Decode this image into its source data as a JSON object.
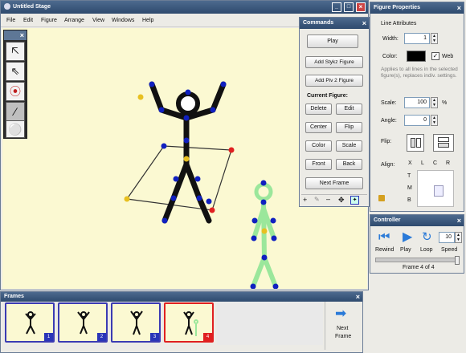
{
  "stage": {
    "title": "Untitled Stage",
    "menu": [
      "File",
      "Edit",
      "Figure",
      "Arrange",
      "View",
      "Windows",
      "Help"
    ],
    "win_controls": [
      "_",
      "□",
      "×"
    ]
  },
  "tools": {
    "close": "×"
  },
  "commands": {
    "title": "Commands",
    "close": "×",
    "play": "Play",
    "add_stykz": "Add Stykz Figure",
    "add_piv2": "Add Piv 2 Figure",
    "current_heading": "Current Figure:",
    "delete": "Delete",
    "edit": "Edit",
    "center": "Center",
    "flip": "Flip",
    "color": "Color",
    "scale": "Scale",
    "front": "Front",
    "back": "Back",
    "next_frame": "Next Frame"
  },
  "props": {
    "title": "Figure Properties",
    "close": "×",
    "line_attr": "Line Attributes",
    "width_label": "Width:",
    "width_value": "1",
    "color_label": "Color:",
    "web_label": "Web",
    "web_checked": true,
    "hint": "Applies to all lines in the selected figure(s), replaces indiv. settings.",
    "scale_label": "Scale:",
    "scale_value": "100",
    "scale_unit": "%",
    "angle_label": "Angle:",
    "angle_value": "0",
    "flip_label": "Flip:",
    "align_label": "Align:",
    "align_cols": [
      "X",
      "L",
      "C",
      "R"
    ],
    "align_rows": [
      "T",
      "M",
      "B"
    ]
  },
  "controller": {
    "title": "Controller",
    "close": "×",
    "rewind": "Rewind",
    "play": "Play",
    "loop": "Loop",
    "speed_value": "10",
    "speed": "Speed",
    "frame_status": "Frame 4 of 4"
  },
  "frames": {
    "title": "Frames",
    "close": "×",
    "items": [
      "1",
      "2",
      "3",
      "4"
    ],
    "next_label_1": "Next",
    "next_label_2": "Frame"
  },
  "colors": {
    "accent": "#2a35b8",
    "selected": "#e02020",
    "canvas": "#fbf9d2",
    "joint": "#1020c0"
  }
}
